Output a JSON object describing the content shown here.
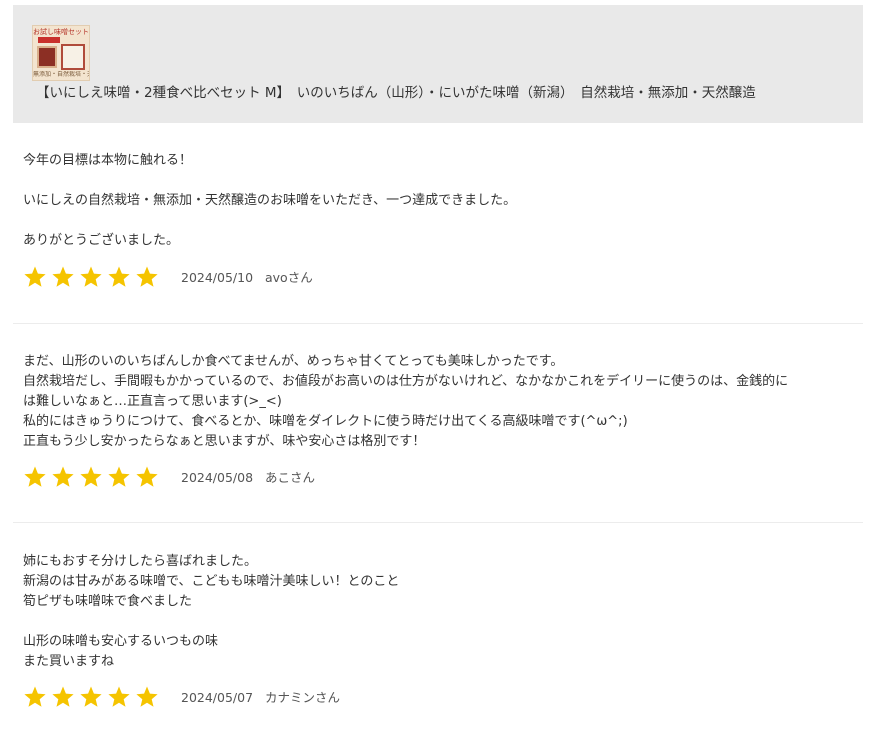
{
  "product": {
    "thumbnail_title": "お試し味噌セット",
    "thumbnail_caption": "無添加・自然栽培・天然醸造",
    "title": "【いにしえ味噌・2種食べ比べセット M】　いのいちばん（山形）・にいがた味噌（新潟）　自然栽培・無添加・天然醸造"
  },
  "reviews": [
    {
      "text": "今年の目標は本物に触れる！\n\nいにしえの自然栽培・無添加・天然醸造のお味噌をいただき、一つ達成できました。\n\nありがとうございました。",
      "rating": 5,
      "date": "2024/05/10",
      "author": "avoさん"
    },
    {
      "text": "まだ、山形のいのいちばんしか食べてませんが、めっちゃ甘くてとっても美味しかったです。\n自然栽培だし、手間暇もかかっているので、お値段がお高いのは仕方がないけれど、なかなかこれをデイリーに使うのは、金銭的に\nは難しいなぁと…正直言って思います(>_<)\n私的にはきゅうりにつけて、食べるとか、味噌をダイレクトに使う時だけ出てくる高級味噌です(^ω^;)\n正直もう少し安かったらなぁと思いますが、味や安心さは格別です！",
      "rating": 5,
      "date": "2024/05/08",
      "author": "あこさん"
    },
    {
      "text": "姉にもおすそ分けしたら喜ばれました。\n新潟のは甘みがある味噌で、こどもも味噌汁美味しい！とのこと\n筍ピザも味噌味で食べました\n\n山形の味噌も安心するいつもの味\nまた買いますね",
      "rating": 5,
      "date": "2024/05/07",
      "author": "カナミンさん"
    }
  ],
  "colors": {
    "star": "#f5c400",
    "header_bg": "#e9e9e9",
    "text": "#333333",
    "meta_text": "#555555",
    "divider": "#ececec"
  },
  "icons": {
    "star": "star-icon"
  }
}
